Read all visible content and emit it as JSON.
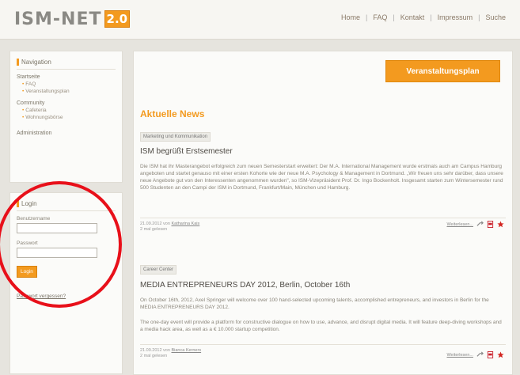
{
  "header": {
    "logo_text": "ISM-NET",
    "logo_badge": "2.0",
    "nav": [
      "Home",
      "FAQ",
      "Kontakt",
      "Impressum",
      "Suche"
    ]
  },
  "sidebar": {
    "navigation_title": "Navigation",
    "groups": [
      {
        "title": "Startseite",
        "items": [
          "FAQ",
          "Veranstaltungsplan"
        ]
      },
      {
        "title": "Community",
        "items": [
          "Cafeteria",
          "Wohnungsbörse"
        ]
      },
      {
        "title": "Administration",
        "items": []
      }
    ],
    "login": {
      "title": "Login",
      "username_label": "Benutzername",
      "username_value": "",
      "password_label": "Passwort",
      "password_value": "",
      "button": "Login",
      "forgot": "Passwort vergessen?"
    }
  },
  "main": {
    "plan_button": "Veranstaltungsplan",
    "news_heading": "Aktuelle News",
    "articles": [
      {
        "tag": "Marketing und Kommunikation",
        "title": "ISM begrüßt Erstsemester",
        "body": "Die ISM hat ihr Masterangebot erfolgreich zum neuen Semesterstart erweitert: Der M.A. International Management wurde erstmals auch am Campus Hamburg angeboten und startet genauso mit einer ersten Kohorte wie der neue M.A. Psychology & Management in Dortmund. „Wir freuen uns sehr darüber, dass unsere neue Angebote gut von den Interessenten angenommen wurden\", so ISM-Vizepräsident Prof. Dr. Ingo Bockenholt. Insgesamt starten zum Wintersemester rund 500 Studenten an den Campi der ISM in Dortmund, Frankfurt/Main, München und Hamburg.",
        "date_prefix": "21.09.2012 von",
        "author": "Katharina Kais",
        "reads": "2 mal gelesen",
        "more": "Weiterlesen..."
      },
      {
        "tag": "Career Center",
        "title": "MEDIA ENTREPRENEURS DAY 2012, Berlin, October 16th",
        "body1": "On October 16th, 2012, Axel Springer will welcome over 100 hand-selected upcoming talents, accomplished entrepreneurs, and investors in Berlin for the MEDIA ENTREPRENEURS DAY 2012.",
        "body2": "The one-day event will provide a platform for constructive dialogue on how to use, advance, and disrupt digital media. It will feature deep-diving workshops and a media hack area, as well as a € 10.000 startup competition.",
        "date_prefix": "21.09.2012 von",
        "author": "Bianca Kerners",
        "reads": "2 mal gelesen",
        "more": "Weiterlesen..."
      }
    ]
  },
  "colors": {
    "accent": "#f39a1f",
    "annotation": "#e8101a"
  }
}
